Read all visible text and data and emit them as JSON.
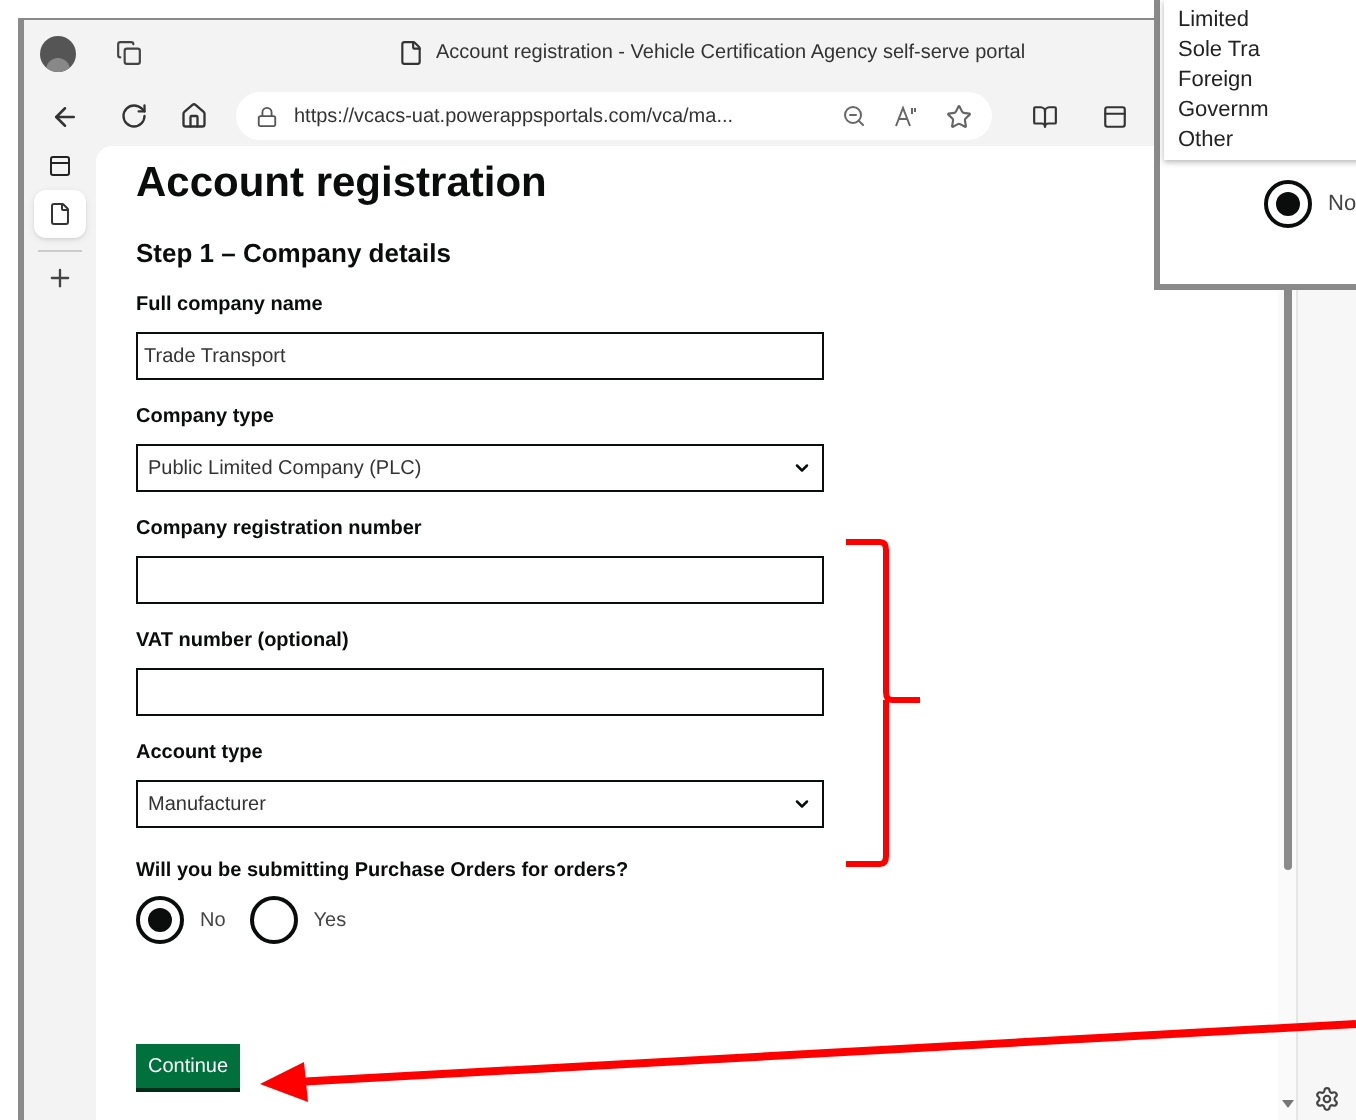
{
  "browser": {
    "tab_title": "Account registration - Vehicle Certification Agency self-serve portal",
    "url": "https://vcacs-uat.powerappsportals.com/vca/ma..."
  },
  "page": {
    "title": "Account registration",
    "step_title": "Step 1 – Company details",
    "fields": [
      {
        "kind": "text",
        "label": "Full company name",
        "value": "Trade Transport"
      },
      {
        "kind": "select",
        "label": "Company type",
        "value": "Public Limited Company (PLC)"
      },
      {
        "kind": "text",
        "label": "Company registration number"
      },
      {
        "kind": "text",
        "label": "VAT number (optional)"
      },
      {
        "kind": "select",
        "label": "Account type",
        "value": "Manufacturer"
      }
    ],
    "question": {
      "label": "Will you be submitting Purchase Orders for orders?",
      "options": [
        {
          "label": "No",
          "selected": true
        },
        {
          "label": "Yes",
          "selected": false
        }
      ]
    },
    "continue_button": "Continue"
  },
  "inset": {
    "dropdown_options": [
      "Limited",
      "Sole Tra",
      "Foreign",
      "Governm",
      "Other"
    ],
    "radio": {
      "label": "No",
      "selected": true
    }
  }
}
